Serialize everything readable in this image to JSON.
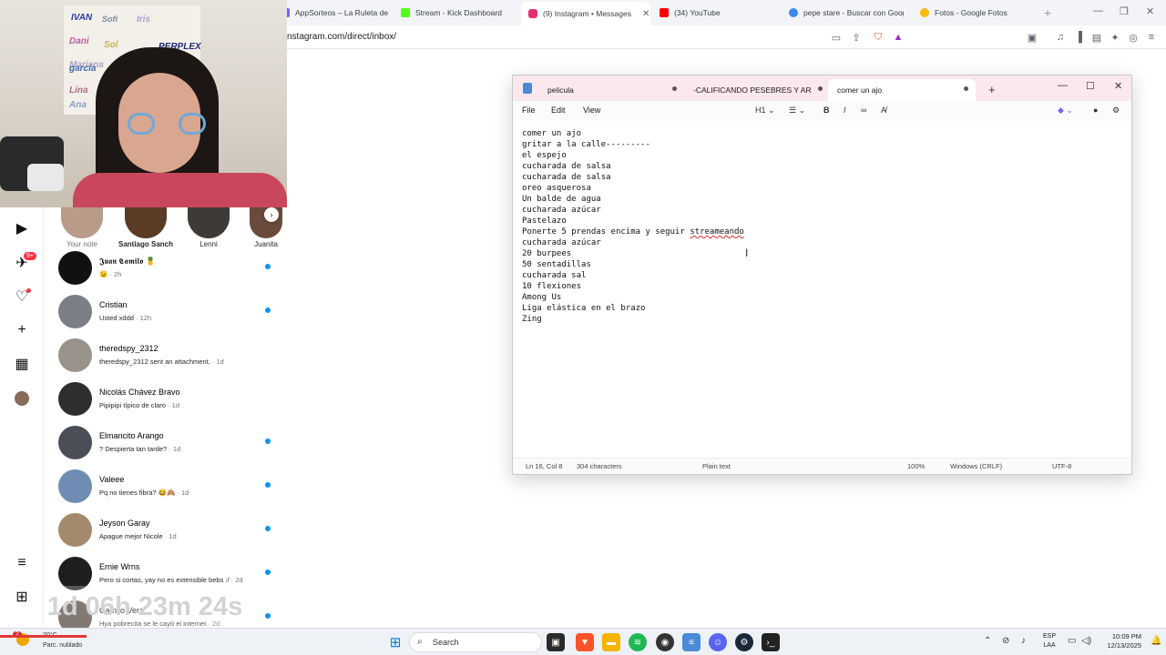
{
  "browser": {
    "tabs": [
      {
        "title": "AppSorteos – La Ruleta de la Suerte",
        "color": "#7b61ff"
      },
      {
        "title": "Stream - Kick Dashboard",
        "color": "#53fc18"
      },
      {
        "title": "(9) Instagram • Messages",
        "color": "#e1306c"
      },
      {
        "title": "(34) YouTube",
        "color": "#ff0000"
      },
      {
        "title": "pepe stare - Buscar con Google",
        "color": "#4285f4"
      },
      {
        "title": "Fotos - Google Fotos",
        "color": "#fbbc04"
      }
    ],
    "url": "nstagram.com/direct/inbox/"
  },
  "instagram": {
    "notification_badge": "9+",
    "notes": [
      {
        "name": "Your note"
      },
      {
        "name": "Santiago Sanch..."
      },
      {
        "name": "Lenni"
      },
      {
        "name": "Juanita"
      }
    ],
    "conversations": [
      {
        "name": "𝕵𝖚𝖆𝖓 𝕮𝖆𝖒𝖎𝖑𝖔 🍍",
        "preview": "😉",
        "time": "· 2h",
        "unread": true,
        "color": "#111111"
      },
      {
        "name": "Cristian",
        "preview": "Usted xddd",
        "time": "· 12h",
        "unread": true,
        "color": "#7a7f86"
      },
      {
        "name": "theredspy_2312",
        "preview": "theredspy_2312 sent an attachment.",
        "time": "· 1d",
        "unread": false,
        "color": "#9a938b"
      },
      {
        "name": "Nicolás Chávez Bravo",
        "preview": "Pipipipi típico de claro",
        "time": "· 1d",
        "unread": false,
        "color": "#2e2e2e"
      },
      {
        "name": "Elmancito Arango",
        "preview": "? Despierta tan tarde?",
        "time": "· 1d",
        "unread": true,
        "color": "#4a4f57"
      },
      {
        "name": "Valeee",
        "preview": "Pq no tienes fibra? 😂🙈",
        "time": "· 1d",
        "unread": true,
        "color": "#6f8db3"
      },
      {
        "name": "Jeyson Garay",
        "preview": "Apague mejor Nicole",
        "time": "· 1d",
        "unread": true,
        "color": "#a48a6c"
      },
      {
        "name": "Ernie Wrns",
        "preview": "Pero si cortas, yay no es extensible bebs :/",
        "time": "· 2d",
        "unread": true,
        "color": "#1f1f1f"
      },
      {
        "name": "Camilo Vera",
        "preview": "Hya pobrecita se le cayó el internet",
        "time": "· 2d",
        "unread": true,
        "color": "#5a4c44"
      }
    ]
  },
  "webcam": {
    "board_names": [
      "IVAN",
      "Sofi",
      "Iris",
      "Dani",
      "PERPLEX",
      "Mariana",
      "Sol",
      "garcía",
      "Lina",
      "Ana"
    ]
  },
  "timer": {
    "text": "1d 06h 23m 24s"
  },
  "notepad": {
    "tabs": [
      {
        "title": "pelicula"
      },
      {
        "title": "-CALIFICANDO PESEBRES Y ARBOLES"
      },
      {
        "title": "comer un ajo"
      }
    ],
    "menu": [
      "File",
      "Edit",
      "View"
    ],
    "heading_selector": "H1",
    "lines": [
      "comer un ajo",
      "gritar a la calle---------",
      "el espejo",
      "cucharada de salsa",
      "cucharada de salsa",
      "oreo asquerosa",
      "Un balde de agua",
      "cucharada azúcar",
      "Pastelazo",
      "Ponerte 5 prendas encima y seguir ",
      "cucharada azúcar",
      "20 burpees",
      "50 sentadillas",
      "cucharada sal",
      "10 flexiones",
      "Among Us",
      "Liga elástica en el brazo",
      "Zing"
    ],
    "misspelled_word": "streameando",
    "status": {
      "position": "Ln 16, Col 8",
      "characters": "304 characters",
      "format": "Plain text",
      "zoom": "100%",
      "line_endings": "Windows (CRLF)",
      "encoding": "UTF-8"
    }
  },
  "taskbar": {
    "weather_badge": "2",
    "temperature": "20°C",
    "weather": "Parc. nublado",
    "search_label": "Search",
    "language": [
      "ESP",
      "LAA"
    ],
    "time": "10:09 PM",
    "date": "12/13/2025"
  }
}
